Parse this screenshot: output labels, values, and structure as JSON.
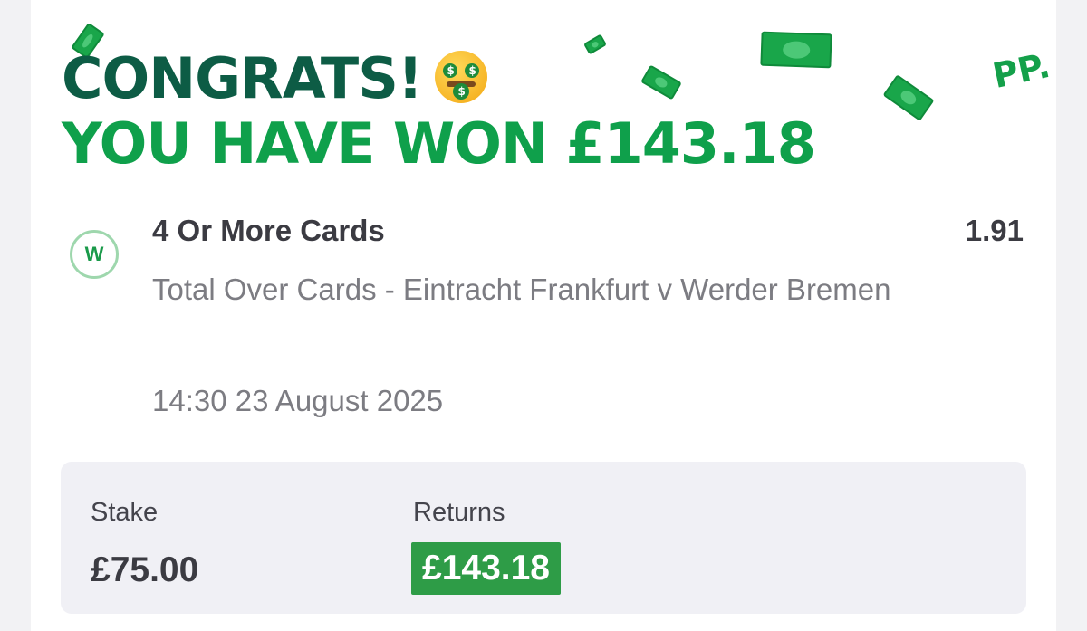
{
  "banner": {
    "line1": "CONGRATS!",
    "emoji": "money-mouth-face",
    "line2": "YOU HAVE WON £143.18",
    "brand_mark": "PP."
  },
  "bet": {
    "status": "W",
    "market": "4 Or More Cards",
    "odds": "1.91",
    "event": "Total Over Cards - Eintracht Frankfurt v Werder Bremen",
    "datetime": "14:30 23 August 2025"
  },
  "summary": {
    "stake_label": "Stake",
    "stake_value": "£75.00",
    "returns_label": "Returns",
    "returns_value": "£143.18"
  },
  "colors": {
    "headline_dark": "#0d5c45",
    "headline_green": "#0fa04b",
    "returns_badge": "#2e9c47",
    "summary_bg": "#f0f0f5"
  }
}
